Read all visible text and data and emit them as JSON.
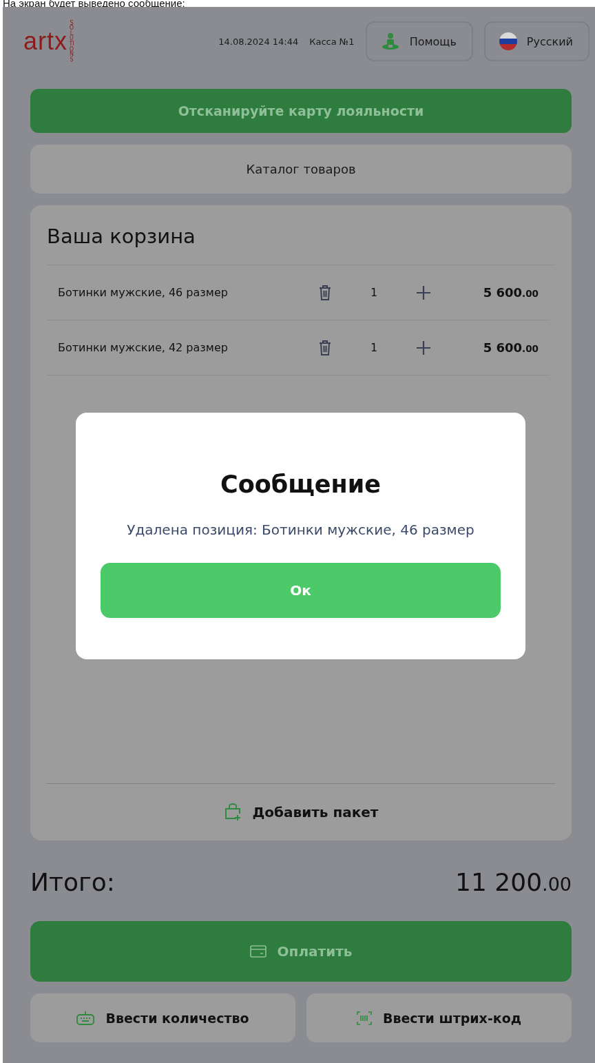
{
  "caption": "На экран будет выведено сообщение:",
  "header": {
    "logo": "artx",
    "logo_sub": "SOLUTIONS",
    "datetime": "14.08.2024 14:44",
    "register": "Касса №1",
    "help_button": "Помощь",
    "language_button": "Русский"
  },
  "loyalty_button": "Отсканируйте карту лояльности",
  "catalog_button": "Каталог товаров",
  "cart": {
    "title": "Ваша корзина",
    "items": [
      {
        "name": "Ботинки мужские, 46 размер",
        "quantity": "1",
        "price": "5 600",
        "cents": ".00"
      },
      {
        "name": "Ботинки мужские, 42 размер",
        "quantity": "1",
        "price": "5 600",
        "cents": ".00"
      }
    ],
    "add_bag_button": "Добавить пакет"
  },
  "total": {
    "label": "Итого:",
    "amount": "11 200",
    "cents": ".00"
  },
  "pay_button": "Оплатить",
  "bottom_buttons": [
    {
      "kind": "quantity",
      "label": "Ввести количество"
    },
    {
      "kind": "barcode",
      "label": "Ввести штрих-код"
    }
  ],
  "dialog": {
    "title": "Сообщение",
    "message": "Удалена позиция: Ботинки мужские, 46 размер",
    "ok_button": "Ок"
  }
}
